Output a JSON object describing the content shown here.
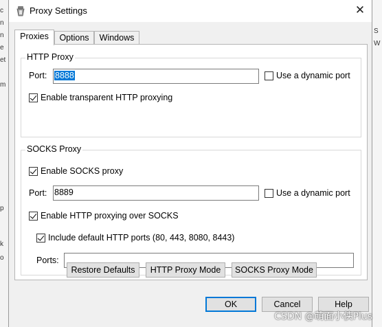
{
  "window": {
    "title": "Proxy Settings",
    "close_glyph": "✕"
  },
  "tabs": [
    {
      "label": "Proxies",
      "active": true
    },
    {
      "label": "Options",
      "active": false
    },
    {
      "label": "Windows",
      "active": false
    }
  ],
  "http_proxy": {
    "group_label": "HTTP Proxy",
    "port_label": "Port:",
    "port_value": "8888",
    "dynamic_port_label": "Use a dynamic port",
    "dynamic_port_checked": false,
    "transparent_label": "Enable transparent HTTP proxying",
    "transparent_checked": true
  },
  "socks_proxy": {
    "group_label": "SOCKS Proxy",
    "enable_label": "Enable SOCKS proxy",
    "enable_checked": true,
    "port_label": "Port:",
    "port_value": "8889",
    "dynamic_port_label": "Use a dynamic port",
    "dynamic_port_checked": false,
    "http_over_socks_label": "Enable HTTP proxying over SOCKS",
    "http_over_socks_checked": true,
    "include_ports_label": "Include default HTTP ports (80, 443, 8080, 8443)",
    "include_ports_checked": true,
    "ports_label": "Ports:",
    "ports_value": ""
  },
  "actions": {
    "restore_defaults": "Restore Defaults",
    "http_proxy_mode": "HTTP Proxy Mode",
    "socks_proxy_mode": "SOCKS Proxy Mode"
  },
  "dialog_buttons": {
    "ok": "OK",
    "cancel": "Cancel",
    "help": "Help"
  },
  "icons": {
    "app": "app-icon",
    "close": "close-icon"
  },
  "background_fragments": {
    "left": [
      "c",
      "n",
      "n",
      "e",
      "et",
      "m",
      "p",
      "k",
      "o"
    ],
    "right": [
      "S",
      "W"
    ]
  },
  "watermark": "CSDN @萌面小侠Plus"
}
